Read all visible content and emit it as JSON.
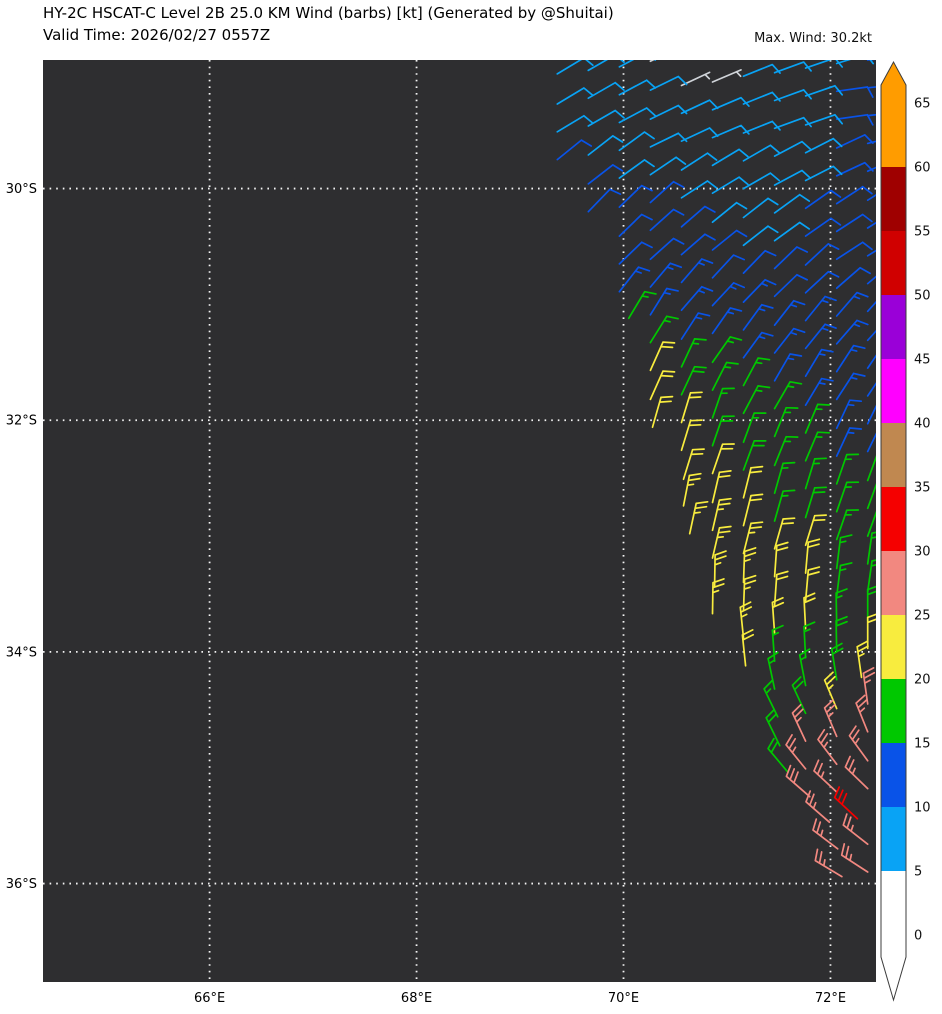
{
  "chart_data": {
    "type": "wind_barbs",
    "title": "HY-2C HSCAT-C Level 2B 25.0 KM Wind (barbs) [kt] (Generated by @Shuitai)",
    "valid_time_label": "Valid Time: 2026/02/27 0557Z",
    "max_wind_label": "Max. Wind: 30.2kt",
    "max_wind_kt": 30.2,
    "unit": "kt",
    "background": "#2e2e30",
    "grid": {
      "style": "dotted",
      "color": "#ffffff"
    },
    "x_axis": {
      "ticks": [
        "66°E",
        "68°E",
        "70°E",
        "72°E"
      ],
      "tick_values": [
        66,
        68,
        70,
        72
      ],
      "range": [
        64.39,
        72.44
      ]
    },
    "y_axis": {
      "ticks": [
        "30°S",
        "32°S",
        "34°S",
        "36°S"
      ],
      "tick_values": [
        -30,
        -32,
        -34,
        -36
      ],
      "range": [
        -36.85,
        -28.89
      ]
    },
    "colorbar": {
      "unit": "kt",
      "levels": [
        0,
        5,
        10,
        15,
        20,
        25,
        30,
        35,
        40,
        45,
        50,
        55,
        60,
        65
      ],
      "colors": [
        "#ffffff",
        "#09a3f5",
        "#0953e8",
        "#00c800",
        "#f8ec3e",
        "#f28880",
        "#f50000",
        "#c08850",
        "#ff00ff",
        "#9a00d8",
        "#d00000",
        "#9f0000",
        "#ff9c00"
      ],
      "over_arrow": "#ff9c00",
      "under_arrow": "#ffffff",
      "tick_labels": [
        65,
        60,
        55,
        50,
        45,
        40,
        35,
        30,
        25,
        20,
        15,
        10,
        5,
        0
      ]
    },
    "barbs_format": [
      "lon_deg_east",
      "lat_deg",
      "wind_from_deg",
      "speed_kt"
    ],
    "barbs": [
      [
        69.36,
        -29.01,
        59,
        8
      ],
      [
        69.66,
        -28.98,
        60,
        8
      ],
      [
        69.96,
        -28.95,
        62,
        8
      ],
      [
        70.26,
        -28.9,
        64,
        4
      ],
      [
        70.56,
        -28.87,
        65,
        4
      ],
      [
        72.36,
        -28.89,
        84,
        12
      ],
      [
        72.06,
        -28.92,
        73,
        8
      ],
      [
        71.76,
        -28.96,
        71,
        8
      ],
      [
        71.46,
        -29.0,
        70,
        8
      ],
      [
        71.16,
        -29.03,
        68,
        8
      ],
      [
        70.86,
        -29.08,
        67,
        4
      ],
      [
        70.56,
        -29.11,
        65,
        4
      ],
      [
        70.26,
        -29.15,
        64,
        8
      ],
      [
        69.96,
        -29.19,
        62,
        8
      ],
      [
        69.66,
        -29.22,
        60,
        8
      ],
      [
        69.36,
        -29.27,
        59,
        8
      ],
      [
        72.36,
        -29.13,
        84,
        12
      ],
      [
        72.06,
        -29.16,
        82,
        12
      ],
      [
        71.76,
        -29.2,
        71,
        8
      ],
      [
        71.46,
        -29.24,
        70,
        8
      ],
      [
        71.16,
        -29.27,
        68,
        8
      ],
      [
        70.86,
        -29.32,
        67,
        8
      ],
      [
        70.56,
        -29.35,
        65,
        8
      ],
      [
        70.26,
        -29.4,
        64,
        8
      ],
      [
        69.96,
        -29.43,
        62,
        8
      ],
      [
        69.66,
        -29.46,
        60,
        8
      ],
      [
        69.36,
        -29.51,
        59,
        8
      ],
      [
        72.36,
        -29.37,
        84,
        12
      ],
      [
        72.06,
        -29.4,
        82,
        12
      ],
      [
        71.76,
        -29.45,
        71,
        8
      ],
      [
        71.46,
        -29.48,
        70,
        8
      ],
      [
        71.16,
        -29.52,
        68,
        8
      ],
      [
        70.86,
        -29.56,
        67,
        8
      ],
      [
        70.56,
        -29.59,
        65,
        8
      ],
      [
        70.26,
        -29.64,
        64,
        8
      ],
      [
        69.96,
        -29.67,
        54,
        8
      ],
      [
        69.66,
        -29.71,
        52,
        8
      ],
      [
        69.36,
        -29.75,
        51,
        12
      ],
      [
        72.36,
        -29.61,
        76,
        12
      ],
      [
        72.06,
        -29.65,
        65,
        12
      ],
      [
        71.76,
        -29.69,
        63,
        8
      ],
      [
        71.46,
        -29.72,
        62,
        8
      ],
      [
        71.16,
        -29.76,
        60,
        8
      ],
      [
        70.86,
        -29.8,
        59,
        8
      ],
      [
        70.56,
        -29.84,
        57,
        8
      ],
      [
        70.26,
        -29.88,
        56,
        8
      ],
      [
        69.96,
        -29.91,
        54,
        8
      ],
      [
        69.66,
        -29.96,
        52,
        12
      ],
      [
        72.36,
        -29.85,
        66,
        12
      ],
      [
        72.06,
        -29.89,
        65,
        12
      ],
      [
        71.76,
        -29.93,
        63,
        8
      ],
      [
        71.46,
        -29.97,
        62,
        8
      ],
      [
        71.16,
        -30.0,
        60,
        8
      ],
      [
        70.86,
        -30.04,
        59,
        8
      ],
      [
        70.56,
        -30.08,
        57,
        8
      ],
      [
        70.26,
        -30.12,
        48,
        12
      ],
      [
        69.96,
        -30.16,
        46,
        12
      ],
      [
        69.66,
        -30.2,
        44,
        12
      ],
      [
        72.36,
        -30.1,
        58,
        12
      ],
      [
        72.06,
        -30.13,
        57,
        12
      ],
      [
        71.76,
        -30.17,
        55,
        12
      ],
      [
        71.46,
        -30.21,
        54,
        8
      ],
      [
        71.16,
        -30.25,
        52,
        8
      ],
      [
        70.86,
        -30.29,
        51,
        8
      ],
      [
        70.56,
        -30.33,
        49,
        12
      ],
      [
        70.26,
        -30.36,
        48,
        12
      ],
      [
        69.96,
        -30.41,
        46,
        12
      ],
      [
        72.36,
        -30.34,
        58,
        12
      ],
      [
        72.06,
        -30.37,
        57,
        12
      ],
      [
        71.76,
        -30.41,
        55,
        12
      ],
      [
        71.46,
        -30.45,
        54,
        8
      ],
      [
        71.16,
        -30.49,
        52,
        8
      ],
      [
        70.86,
        -30.53,
        51,
        12
      ],
      [
        70.56,
        -30.57,
        49,
        12
      ],
      [
        70.26,
        -30.61,
        48,
        12
      ],
      [
        69.96,
        -30.65,
        46,
        12
      ],
      [
        72.36,
        -30.58,
        58,
        12
      ],
      [
        72.06,
        -30.61,
        57,
        12
      ],
      [
        71.76,
        -30.66,
        47,
        12
      ],
      [
        71.46,
        -30.69,
        46,
        12
      ],
      [
        71.16,
        -30.73,
        44,
        12
      ],
      [
        70.86,
        -30.77,
        43,
        12
      ],
      [
        70.56,
        -30.81,
        41,
        14
      ],
      [
        70.26,
        -30.85,
        40,
        14
      ],
      [
        69.96,
        -30.89,
        38,
        14
      ],
      [
        72.36,
        -30.82,
        50,
        12
      ],
      [
        72.06,
        -30.86,
        49,
        12
      ],
      [
        71.76,
        -30.9,
        47,
        12
      ],
      [
        71.46,
        -30.93,
        46,
        12
      ],
      [
        71.16,
        -30.98,
        44,
        14
      ],
      [
        70.86,
        -31.01,
        43,
        14
      ],
      [
        70.56,
        -31.05,
        41,
        14
      ],
      [
        70.26,
        -31.09,
        32,
        14
      ],
      [
        70.05,
        -31.12,
        31,
        17
      ],
      [
        72.36,
        -31.06,
        42,
        14
      ],
      [
        72.06,
        -31.1,
        41,
        14
      ],
      [
        71.76,
        -31.14,
        39,
        14
      ],
      [
        71.46,
        -31.18,
        38,
        14
      ],
      [
        71.16,
        -31.22,
        36,
        14
      ],
      [
        70.86,
        -31.25,
        35,
        14
      ],
      [
        70.56,
        -31.3,
        33,
        14
      ],
      [
        70.26,
        -31.33,
        32,
        17
      ],
      [
        72.36,
        -31.31,
        42,
        14
      ],
      [
        72.06,
        -31.34,
        41,
        14
      ],
      [
        71.76,
        -31.38,
        39,
        14
      ],
      [
        71.46,
        -31.42,
        38,
        14
      ],
      [
        71.16,
        -31.46,
        36,
        14
      ],
      [
        70.86,
        -31.5,
        35,
        17
      ],
      [
        70.56,
        -31.54,
        25,
        17
      ],
      [
        70.26,
        -31.57,
        24,
        22
      ],
      [
        72.36,
        -31.55,
        34,
        14
      ],
      [
        72.06,
        -31.58,
        33,
        14
      ],
      [
        71.76,
        -31.62,
        31,
        14
      ],
      [
        71.46,
        -31.66,
        30,
        14
      ],
      [
        71.16,
        -31.7,
        28,
        17
      ],
      [
        70.86,
        -31.74,
        27,
        17
      ],
      [
        70.56,
        -31.78,
        25,
        19
      ],
      [
        70.26,
        -31.82,
        24,
        22
      ],
      [
        72.36,
        -31.79,
        34,
        14
      ],
      [
        72.06,
        -31.82,
        33,
        14
      ],
      [
        71.76,
        -31.87,
        31,
        14
      ],
      [
        71.46,
        -31.9,
        30,
        17
      ],
      [
        71.16,
        -31.94,
        28,
        17
      ],
      [
        70.86,
        -31.98,
        19,
        17
      ],
      [
        70.56,
        -32.02,
        17,
        22
      ],
      [
        70.28,
        -32.06,
        16,
        22
      ],
      [
        72.36,
        -32.03,
        26,
        14
      ],
      [
        72.06,
        -32.07,
        25,
        14
      ],
      [
        71.76,
        -32.11,
        23,
        17
      ],
      [
        71.46,
        -32.14,
        22,
        17
      ],
      [
        71.16,
        -32.19,
        20,
        17
      ],
      [
        70.86,
        -32.22,
        19,
        19
      ],
      [
        70.56,
        -32.26,
        17,
        22
      ],
      [
        72.36,
        -32.27,
        26,
        14
      ],
      [
        72.06,
        -32.31,
        25,
        14
      ],
      [
        71.76,
        -32.35,
        23,
        17
      ],
      [
        71.46,
        -32.39,
        22,
        17
      ],
      [
        71.16,
        -32.43,
        20,
        19
      ],
      [
        70.86,
        -32.46,
        19,
        22
      ],
      [
        70.58,
        -32.51,
        17,
        22
      ],
      [
        72.36,
        -32.52,
        20,
        17
      ],
      [
        72.06,
        -32.55,
        19,
        17
      ],
      [
        71.76,
        -32.59,
        17,
        17
      ],
      [
        71.46,
        -32.63,
        16,
        17
      ],
      [
        71.16,
        -32.67,
        14,
        22
      ],
      [
        70.86,
        -32.71,
        13,
        22
      ],
      [
        70.58,
        -32.74,
        11,
        24
      ],
      [
        72.36,
        -32.76,
        20,
        17
      ],
      [
        72.06,
        -32.79,
        19,
        17
      ],
      [
        71.76,
        -32.84,
        17,
        19
      ],
      [
        71.46,
        -32.87,
        16,
        17
      ],
      [
        71.16,
        -32.91,
        14,
        22
      ],
      [
        70.86,
        -32.95,
        13,
        24
      ],
      [
        70.64,
        -32.98,
        12,
        24
      ],
      [
        72.36,
        -33.0,
        20,
        19
      ],
      [
        72.06,
        -33.03,
        19,
        17
      ],
      [
        71.76,
        -33.08,
        17,
        22
      ],
      [
        71.46,
        -33.11,
        16,
        22
      ],
      [
        71.16,
        -33.15,
        14,
        24
      ],
      [
        70.86,
        -33.19,
        13,
        24
      ],
      [
        72.36,
        -33.24,
        8,
        19
      ],
      [
        72.06,
        -33.28,
        7,
        17
      ],
      [
        71.76,
        -33.32,
        5,
        22
      ],
      [
        71.46,
        -33.35,
        4,
        22
      ],
      [
        71.16,
        -33.4,
        2,
        24
      ],
      [
        70.88,
        -33.43,
        1,
        24
      ],
      [
        72.36,
        -33.48,
        8,
        19
      ],
      [
        72.06,
        -33.52,
        7,
        17
      ],
      [
        71.76,
        -33.56,
        5,
        22
      ],
      [
        71.46,
        -33.6,
        4,
        22
      ],
      [
        71.16,
        -33.64,
        2,
        24
      ],
      [
        70.86,
        -33.67,
        1,
        24
      ],
      [
        72.36,
        -33.73,
        360,
        19
      ],
      [
        72.06,
        -33.76,
        359,
        17
      ],
      [
        71.76,
        -33.8,
        357,
        22
      ],
      [
        71.46,
        -33.84,
        356,
        22
      ],
      [
        71.16,
        -33.88,
        354,
        24
      ],
      [
        72.36,
        -33.97,
        360,
        22
      ],
      [
        72.06,
        -34.0,
        359,
        19
      ],
      [
        71.76,
        -34.05,
        357,
        17
      ],
      [
        71.46,
        -34.08,
        356,
        17
      ],
      [
        71.18,
        -34.12,
        354,
        22
      ],
      [
        72.3,
        -34.22,
        352,
        24
      ],
      [
        72.06,
        -34.24,
        351,
        19
      ],
      [
        71.76,
        -34.29,
        349,
        17
      ],
      [
        71.46,
        -34.32,
        348,
        17
      ],
      [
        72.36,
        -34.45,
        352,
        27
      ],
      [
        72.06,
        -34.49,
        337,
        24
      ],
      [
        71.76,
        -34.53,
        335,
        19
      ],
      [
        71.49,
        -34.56,
        334,
        17
      ],
      [
        72.36,
        -34.69,
        338,
        27
      ],
      [
        72.06,
        -34.73,
        337,
        27
      ],
      [
        71.76,
        -34.77,
        335,
        27
      ],
      [
        71.51,
        -34.81,
        334,
        19
      ],
      [
        72.36,
        -34.94,
        324,
        27
      ],
      [
        72.06,
        -34.97,
        323,
        27
      ],
      [
        71.76,
        -35.01,
        321,
        27
      ],
      [
        71.59,
        -35.04,
        320,
        19
      ],
      [
        72.36,
        -35.18,
        314,
        27
      ],
      [
        72.06,
        -35.21,
        313,
        27
      ],
      [
        71.8,
        -35.25,
        311,
        29
      ],
      [
        72.26,
        -35.44,
        313,
        31
      ],
      [
        71.99,
        -35.47,
        311,
        27
      ],
      [
        72.36,
        -35.66,
        308,
        27
      ],
      [
        72.07,
        -35.7,
        307,
        27
      ],
      [
        72.36,
        -35.9,
        303,
        27
      ],
      [
        72.11,
        -35.94,
        301,
        27
      ]
    ]
  }
}
